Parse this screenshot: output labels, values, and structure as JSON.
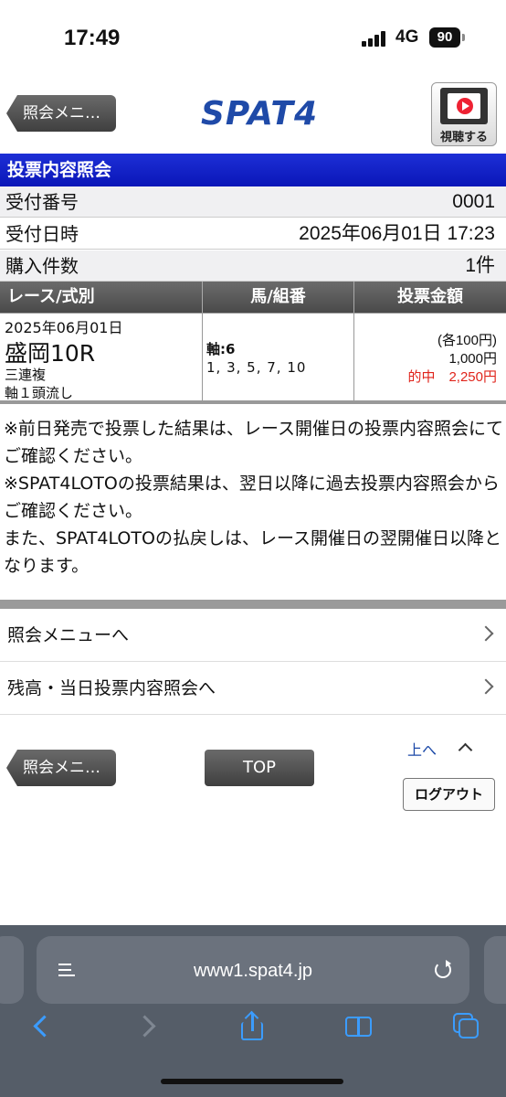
{
  "status_bar": {
    "time": "17:49",
    "network": "4G",
    "battery": "90"
  },
  "header": {
    "back_label": "照会メニ…",
    "logo": "SPAT4",
    "watch_label": "視聴する"
  },
  "title": "投票内容照会",
  "info": {
    "receipt_label": "受付番号",
    "receipt_value": "0001",
    "datetime_label": "受付日時",
    "datetime_value": "2025年06月01日 17:23",
    "count_label": "購入件数",
    "count_value": "1件"
  },
  "bet_table": {
    "headers": [
      "レース/式別",
      "馬/組番",
      "投票金額"
    ],
    "row": {
      "date": "2025年06月01日",
      "race": "盛岡10R",
      "bet_type": "三連複",
      "method": "軸１頭流し",
      "axis": "軸:6",
      "combos": "1, 3, 5, 7, 10",
      "unit": "(各100円)",
      "total": "1,000円",
      "hit": "的中　2,250円"
    }
  },
  "notes": {
    "line1": "※前日発売で投票した結果は、レース開催日の投票内容照会にてご確認ください。",
    "line2": "※SPAT4LOTOの投票結果は、翌日以降に過去投票内容照会からご確認ください。",
    "line3": "また、SPAT4LOTOの払戻しは、レース開催日の翌開催日以降となります。"
  },
  "links": [
    "照会メニューへ",
    "残高・当日投票内容照会へ"
  ],
  "footer": {
    "back_label": "照会メニ…",
    "top_label": "TOP",
    "up_label": "上へ",
    "logout_label": "ログアウト"
  },
  "browser": {
    "url": "www1.spat4.jp"
  },
  "colors": {
    "title_bar": "#0a16b8",
    "hit": "#e0241b",
    "link": "#1d4aa8",
    "ios_blue": "#3b9cff"
  }
}
